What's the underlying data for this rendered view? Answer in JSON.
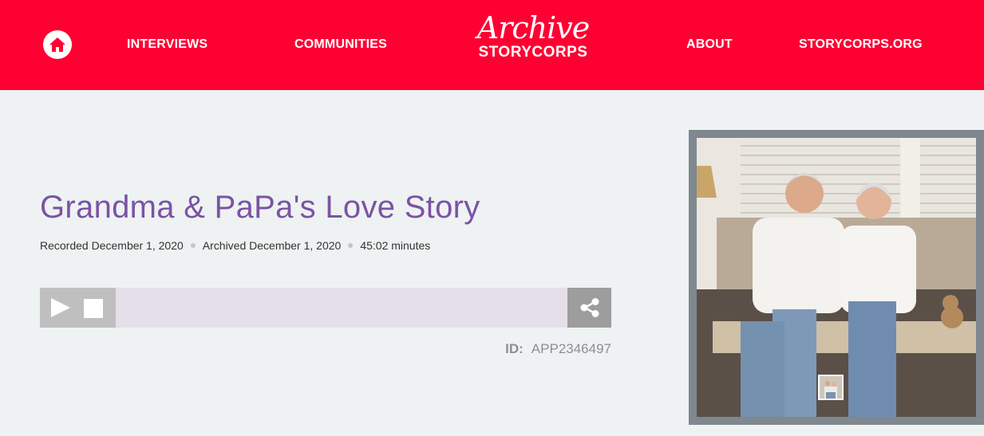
{
  "nav": {
    "links": [
      "INTERVIEWS",
      "COMMUNITIES",
      "ABOUT",
      "STORYCORPS.ORG"
    ]
  },
  "logo": {
    "script": "Archive",
    "wordmark": "STORYCORPS"
  },
  "interview": {
    "title": "Grandma & PaPa's Love Story",
    "recorded": "Recorded December 1, 2020",
    "archived": "Archived December 1, 2020",
    "duration": "45:02 minutes",
    "id_label": "ID:",
    "id_value": "APP2346497"
  },
  "colors": {
    "brand_red": "#ff0033",
    "title_purple": "#7b53a5",
    "page_bg": "#eef2f2"
  },
  "icons": [
    "home-icon",
    "play-icon",
    "stop-icon",
    "share-icon"
  ]
}
